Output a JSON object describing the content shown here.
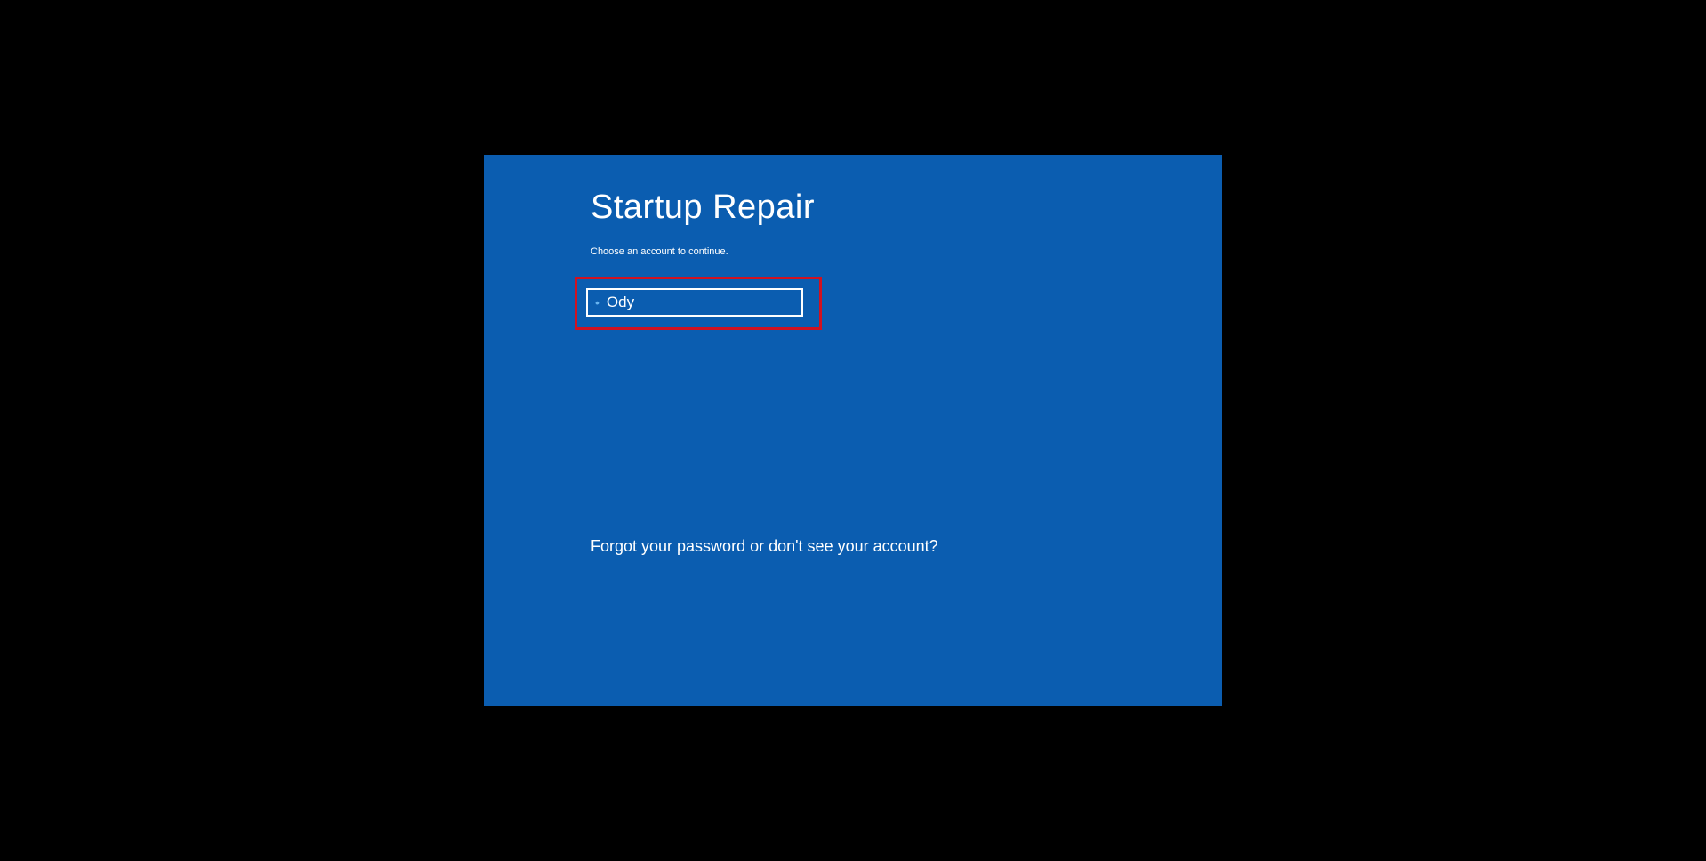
{
  "screen": {
    "title": "Startup Repair",
    "subtitle": "Choose an account to continue.",
    "accounts": [
      {
        "name": "Ody"
      }
    ],
    "forgot_text": "Forgot your password or don't see your account?"
  }
}
